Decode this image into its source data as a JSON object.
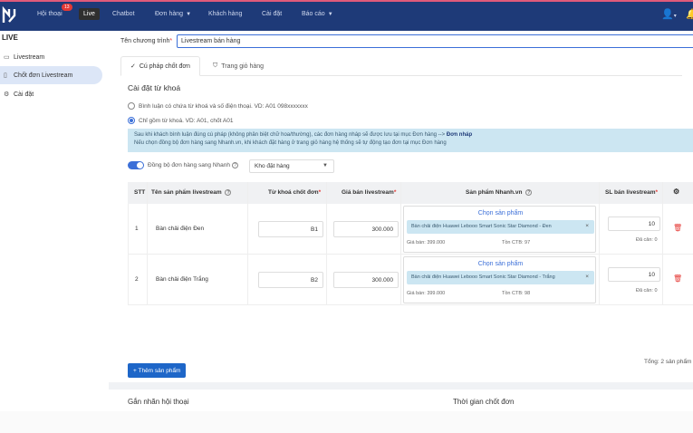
{
  "nav": {
    "items": [
      {
        "label": "Hội thoại",
        "badge": "13"
      },
      {
        "label": "Live"
      },
      {
        "label": "Chatbot"
      },
      {
        "label": "Đơn hàng"
      },
      {
        "label": "Khách hàng"
      },
      {
        "label": "Cài đặt"
      },
      {
        "label": "Báo cáo"
      }
    ],
    "user_icon": "user-icon",
    "bell_icon": "bell-icon"
  },
  "sidebar": {
    "title": "LIVE",
    "items": [
      {
        "label": "Livestream",
        "icon": "video-icon"
      },
      {
        "label": "Chốt đơn Livestream",
        "icon": "order-icon"
      },
      {
        "label": "Cài đặt",
        "icon": "gear-icon"
      }
    ]
  },
  "program": {
    "label": "Tên chương trình",
    "required_mark": "*",
    "value": "Livestream bán hàng"
  },
  "tabs": [
    {
      "label": "Cú pháp chốt đơn"
    },
    {
      "label": "Trang giỏ hàng"
    }
  ],
  "keywords": {
    "title": "Cài đặt từ khoá",
    "option_1": "Bình luận có chứa từ khoá và số điện thoại. VD: A01 098xxxxxxx",
    "option_2": "Chỉ gồm từ khoá. VD: A01, chốt A01",
    "info_line_1": "Sau khi khách bình luận đúng cú pháp (không phân biệt chữ hoa/thường), các đơn hàng nháp sẽ được lưu tại mục Đơn hàng -->",
    "info_line_1_link": "Đơn nháp",
    "info_line_2": "Nếu chọn đồng bộ đơn hàng sang Nhanh.vn, khi khách đặt hàng ở trang giỏ hàng hệ thống sẽ tự động tạo đơn tại mục Đơn hàng",
    "sync_label": "Đồng bộ đơn hàng sang Nhanh",
    "sync_select": "Kho đặt hàng"
  },
  "table": {
    "headers": {
      "stt": "STT",
      "name": "Tên sản phẩm livestream",
      "keyword": "Từ khoá chốt đơn",
      "price": "Giá bán livestream",
      "product": "Sản phẩm Nhanh.vn",
      "qty": "SL bán livestream",
      "required_mark": "*"
    },
    "rows": [
      {
        "stt": "1",
        "name": "Bàn chải điện Đen",
        "keyword": "B1",
        "price": "300.000",
        "choose": "Chọn sản phẩm",
        "product": "Bàn chải điện Huawei Lebooo Smart Sonic Star Diamond - Đen",
        "list_price": "Giá bán: 399.000",
        "stock": "Tồn CTB: 97",
        "qty": "10",
        "sold": "Đã cân: 0"
      },
      {
        "stt": "2",
        "name": "Bàn chải điện Trắng",
        "keyword": "B2",
        "price": "300.000",
        "choose": "Chọn sản phẩm",
        "product": "Bàn chải điện Huawei Lebooo Smart Sonic Star Diamond - Trắng",
        "list_price": "Giá bán: 399.000",
        "stock": "Tồn CTB: 98",
        "qty": "10",
        "sold": "Đã cân: 0"
      }
    ]
  },
  "add_button": "+ Thêm sản phẩm",
  "total": "Tổng: 2 sản phẩm",
  "cards": {
    "left": "Gắn nhãn hội thoại",
    "right": "Thời gian chốt đơn"
  },
  "colors": {
    "nav_bg": "#1e3a78",
    "accent": "#3b6fd8",
    "info_bg": "#cce6f2",
    "danger": "#e53935"
  }
}
